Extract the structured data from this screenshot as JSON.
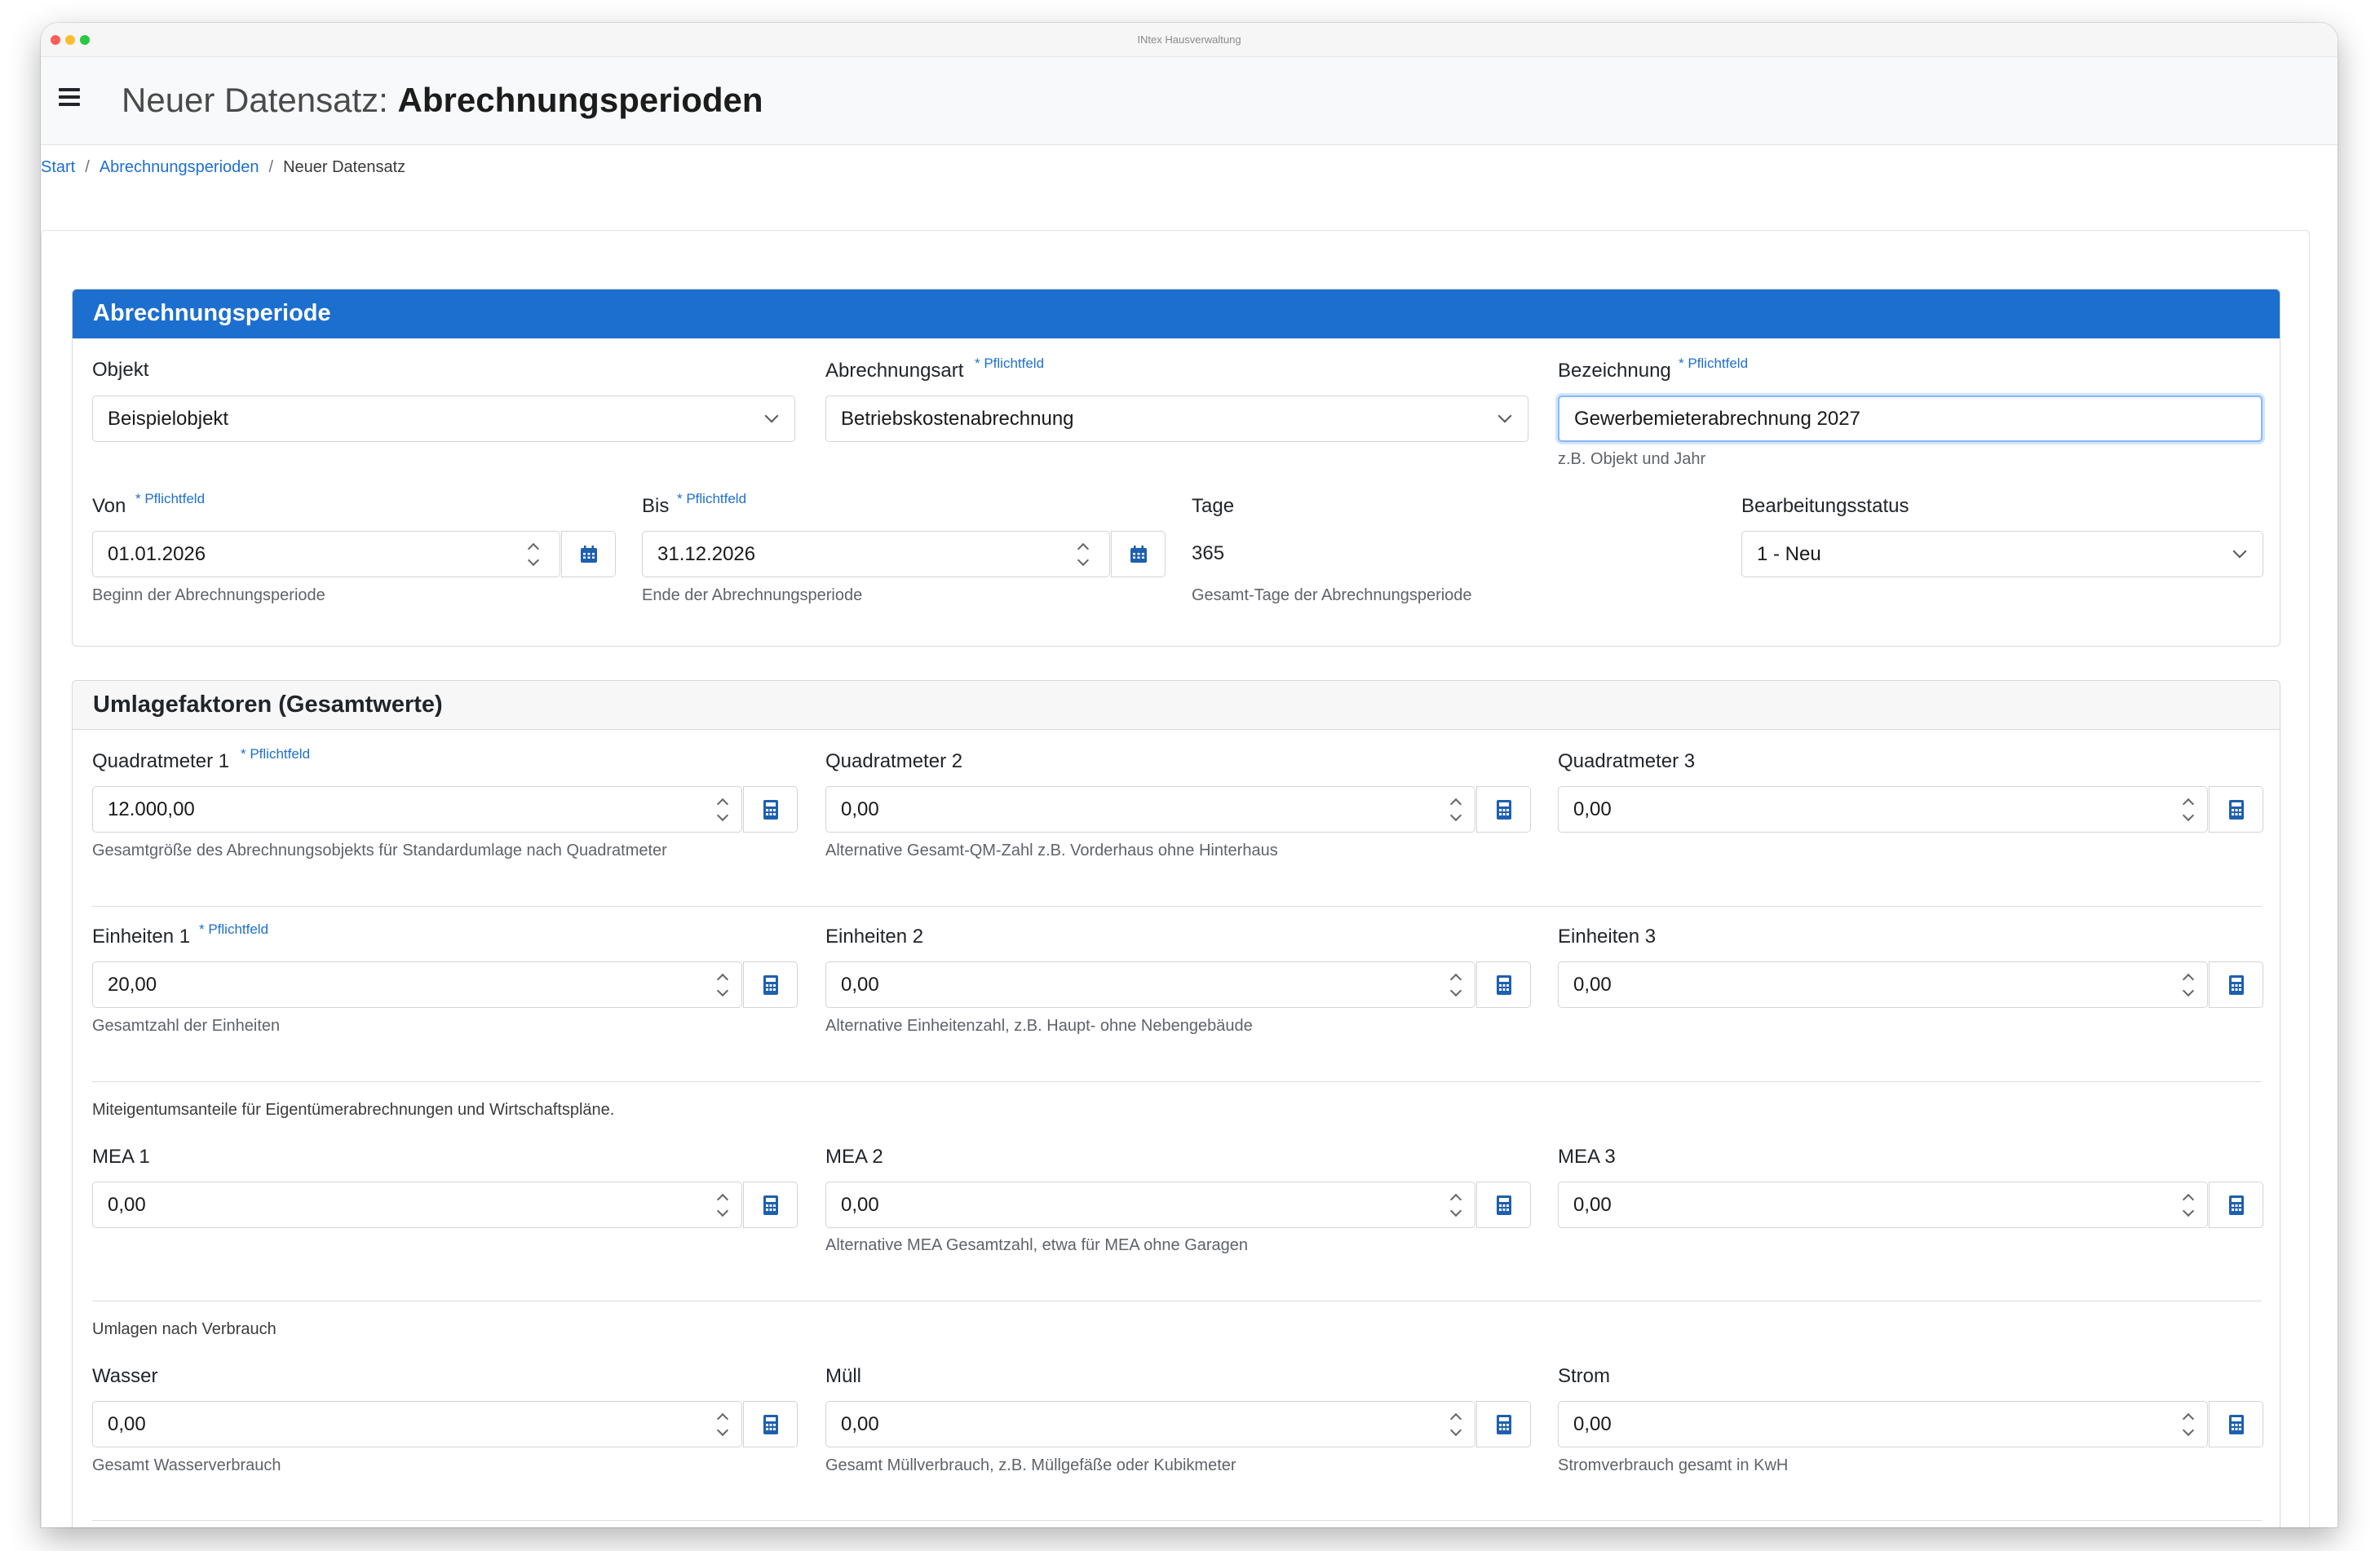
{
  "window": {
    "title": "INtex Hausverwaltung"
  },
  "header": {
    "title_prefix": "Neuer Datensatz:",
    "title_bold": "Abrechnungsperioden"
  },
  "breadcrumb": {
    "items": [
      "Start",
      "Abrechnungsperioden"
    ],
    "current": "Neuer Datensatz"
  },
  "required_label": "* Pflichtfeld",
  "section1": {
    "title": "Abrechnungsperiode",
    "objekt": {
      "label": "Objekt",
      "value": "Beispielobjekt"
    },
    "abrechnungsart": {
      "label": "Abrechnungsart",
      "value": "Betriebskostenabrechnung"
    },
    "bezeichnung": {
      "label": "Bezeichnung",
      "value": "Gewerbemieterabrechnung 2027",
      "help": "z.B. Objekt und Jahr"
    },
    "von": {
      "label": "Von",
      "value": "01.01.2026",
      "help": "Beginn der Abrechnungsperiode"
    },
    "bis": {
      "label": "Bis",
      "value": "31.12.2026",
      "help": "Ende der Abrechnungsperiode"
    },
    "tage": {
      "label": "Tage",
      "value": "365",
      "help": "Gesamt-Tage der Abrechnungsperiode"
    },
    "status": {
      "label": "Bearbeitungsstatus",
      "value": "1 - Neu"
    }
  },
  "section2": {
    "title": "Umlagefaktoren (Gesamtwerte)",
    "rows": [
      {
        "note": "",
        "fields": [
          {
            "label": "Quadratmeter 1",
            "required": true,
            "value": "12.000,00",
            "help": "Gesamtgröße des Abrechnungsobjekts für Standardumlage nach Quadratmeter"
          },
          {
            "label": "Quadratmeter 2",
            "required": false,
            "value": "0,00",
            "help": "Alternative Gesamt-QM-Zahl z.B. Vorderhaus ohne Hinterhaus"
          },
          {
            "label": "Quadratmeter 3",
            "required": false,
            "value": "0,00",
            "help": ""
          }
        ]
      },
      {
        "note": "",
        "fields": [
          {
            "label": "Einheiten 1",
            "required": true,
            "value": "20,00",
            "help": "Gesamtzahl der Einheiten"
          },
          {
            "label": "Einheiten 2",
            "required": false,
            "value": "0,00",
            "help": "Alternative Einheitenzahl, z.B. Haupt- ohne Nebengebäude"
          },
          {
            "label": "Einheiten 3",
            "required": false,
            "value": "0,00",
            "help": ""
          }
        ]
      },
      {
        "note": "Miteigentumsanteile für Eigentümerabrechnungen und Wirtschaftspläne.",
        "fields": [
          {
            "label": "MEA 1",
            "required": false,
            "value": "0,00",
            "help": ""
          },
          {
            "label": "MEA 2",
            "required": false,
            "value": "0,00",
            "help": "Alternative MEA Gesamtzahl, etwa für MEA ohne Garagen"
          },
          {
            "label": "MEA 3",
            "required": false,
            "value": "0,00",
            "help": ""
          }
        ]
      },
      {
        "note": "Umlagen nach Verbrauch",
        "fields": [
          {
            "label": "Wasser",
            "required": false,
            "value": "0,00",
            "help": "Gesamt Wasserverbrauch"
          },
          {
            "label": "Müll",
            "required": false,
            "value": "0,00",
            "help": "Gesamt Müllverbrauch, z.B. Müllgefäße oder Kubikmeter"
          },
          {
            "label": "Strom",
            "required": false,
            "value": "0,00",
            "help": "Stromverbrauch gesamt in KwH"
          }
        ]
      }
    ]
  },
  "colors": {
    "primary": "#1c6fcf",
    "link": "#1e6fd0",
    "icon": "#1e5fb0"
  }
}
